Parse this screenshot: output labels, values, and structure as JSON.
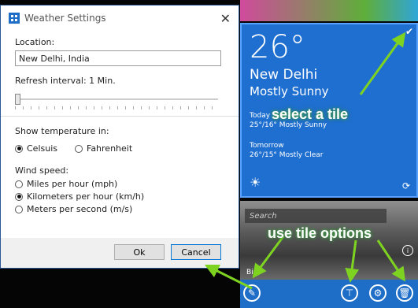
{
  "dialog": {
    "title": "Weather Settings",
    "location_label": "Location:",
    "location_value": "New Delhi, India",
    "refresh_label": "Refresh interval: 1 Min.",
    "refresh_level": 0,
    "temp_label": "Show temperature in:",
    "temp_options": [
      "Celsuis",
      "Fahrenheit"
    ],
    "temp_selected": "Celsuis",
    "wind_label": "Wind speed:",
    "wind_options": [
      "Miles per hour (mph)",
      "Kilometers per hour (km/h)",
      "Meters per second (m/s)"
    ],
    "wind_selected": "Kilometers per hour (km/h)",
    "ok_label": "Ok",
    "cancel_label": "Cancel"
  },
  "weather_tile": {
    "temperature": "26°",
    "city": "New Delhi",
    "condition": "Mostly Sunny",
    "today_label": "Today",
    "today_forecast": "25°/16° Mostly Sunny",
    "tomorrow_label": "Tomorrow",
    "tomorrow_forecast": "26°/15° Mostly Clear"
  },
  "photo_tile": {
    "search_placeholder": "Search",
    "caption": "Birl"
  },
  "annotations": {
    "select_tile": "select a tile",
    "tile_options": "use tile options"
  },
  "icons": {
    "check": "check-icon",
    "sun": "sun-icon",
    "refresh": "refresh-icon",
    "edit": "pencil-icon",
    "pin": "pin-icon",
    "settings": "gear-icon",
    "delete": "trash-icon"
  },
  "colors": {
    "tile_blue": "#1f6fd0",
    "annotation_green": "#4caf50"
  }
}
